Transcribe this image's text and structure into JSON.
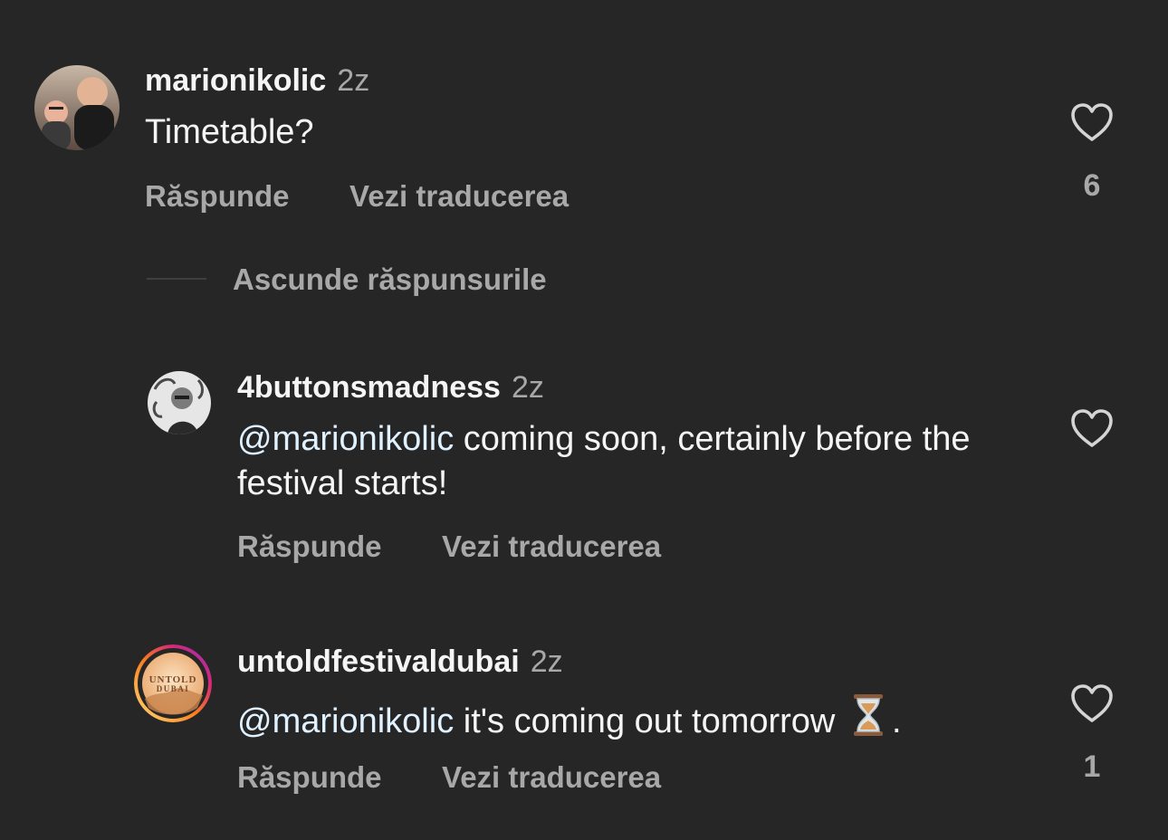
{
  "comments": [
    {
      "username": "marionikolic",
      "time": "2z",
      "text": "Timetable?",
      "reply_label": "Răspunde",
      "translate_label": "Vezi traducerea",
      "likes": "6",
      "like_icon": "heart-outline-icon"
    }
  ],
  "toggle_replies": {
    "label": "Ascunde răspunsurile"
  },
  "replies": [
    {
      "username": "4buttonsmadness",
      "time": "2z",
      "mention": "@marionikolic",
      "text": " coming soon, certainly before the festival starts!",
      "reply_label": "Răspunde",
      "translate_label": "Vezi traducerea",
      "like_icon": "heart-outline-icon"
    },
    {
      "username": "untoldfestivaldubai",
      "time": "2z",
      "mention": "@marionikolic",
      "text": " it's coming out tomorrow",
      "emoji_icon": "hourglass-icon",
      "text_end": ".",
      "avatar_logo_text": "UNTOLD DUBAI",
      "reply_label": "Răspunde",
      "translate_label": "Vezi traducerea",
      "likes": "1",
      "like_icon": "heart-outline-icon"
    }
  ],
  "colors": {
    "background": "#262626",
    "primary_text": "#f5f5f5",
    "secondary_text": "#a8a8a8",
    "mention": "#e0f1ff",
    "story_ring_start": "#feda75",
    "story_ring_end": "#d62976"
  }
}
